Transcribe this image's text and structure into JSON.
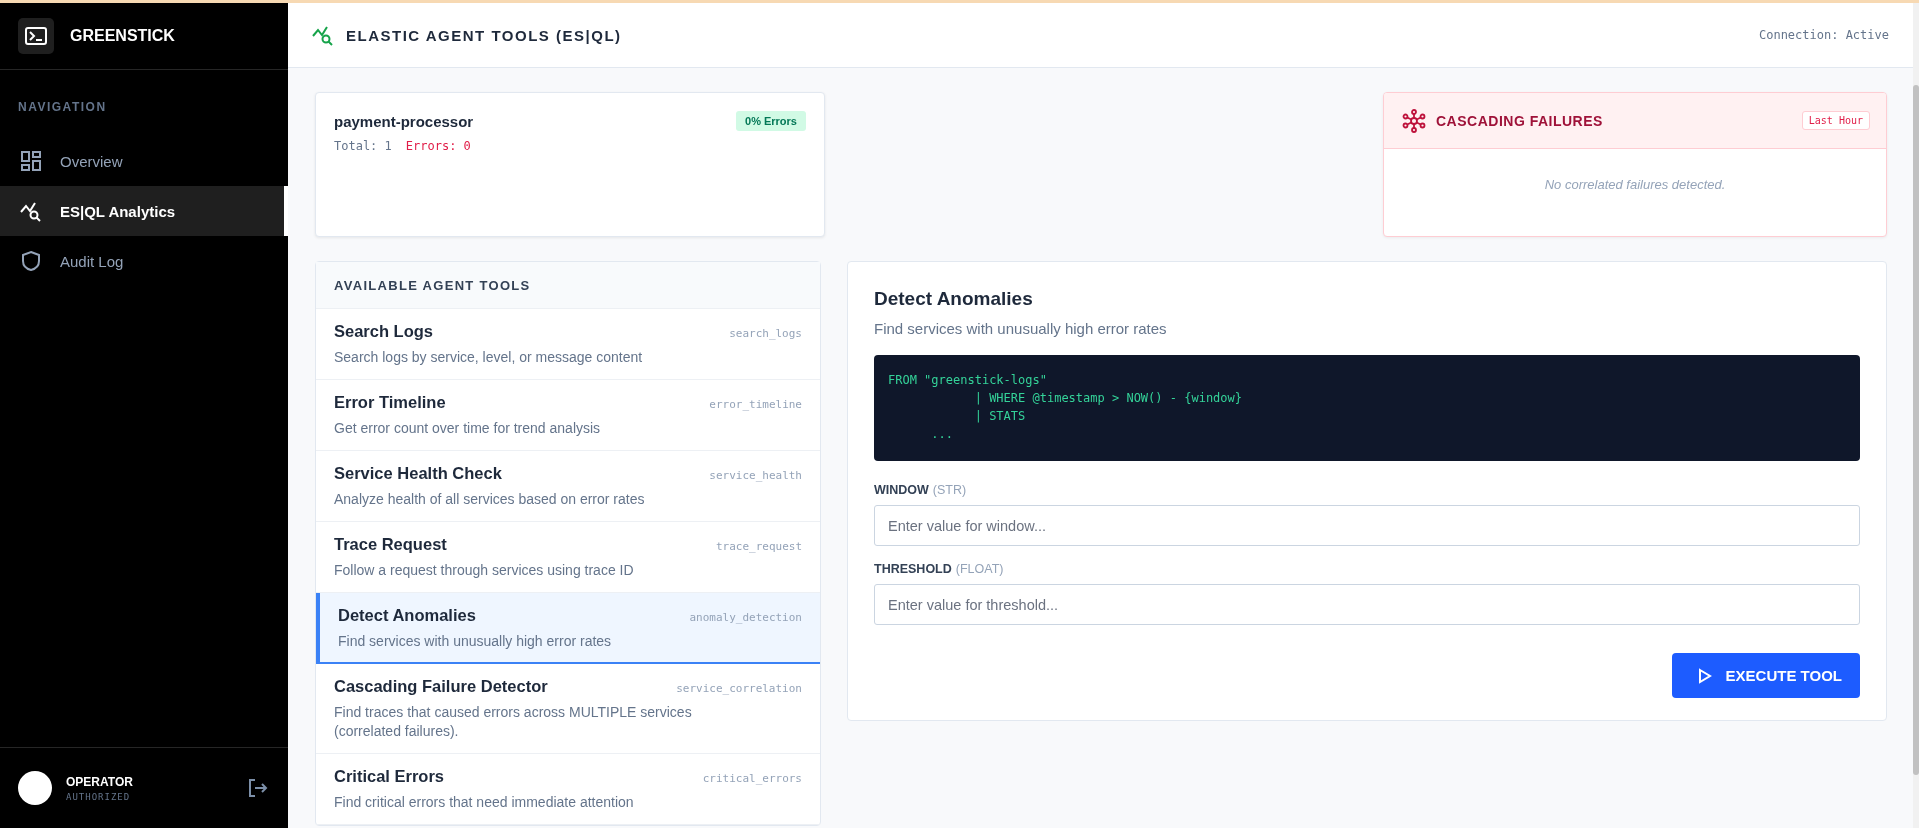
{
  "brand": {
    "name": "GREENSTICK"
  },
  "sidebar": {
    "section": "NAVIGATION",
    "items": [
      {
        "label": "Overview",
        "kind": "grid",
        "selected": false
      },
      {
        "label": "ES|QL Analytics",
        "kind": "chart",
        "selected": true
      },
      {
        "label": "Audit Log",
        "kind": "shield",
        "selected": false
      }
    ],
    "user": {
      "name": "OPERATOR",
      "role": "AUTHORIZED"
    }
  },
  "header": {
    "title": "ELASTIC AGENT TOOLS (ES|QL)",
    "status": "Connection: Active"
  },
  "service_card": {
    "name": "payment-processor",
    "badge": "0% Errors",
    "total": "Total: 1",
    "errors": "Errors: 0"
  },
  "cascading": {
    "title": "CASCADING FAILURES",
    "badge": "Last Hour",
    "empty": "No correlated failures detected."
  },
  "tools": {
    "title": "AVAILABLE AGENT TOOLS",
    "items": [
      {
        "name": "Search Logs",
        "id": "search_logs",
        "description": "Search logs by service, level, or message content",
        "selected": false
      },
      {
        "name": "Error Timeline",
        "id": "error_timeline",
        "description": "Get error count over time for trend analysis",
        "selected": false
      },
      {
        "name": "Service Health Check",
        "id": "service_health",
        "description": "Analyze health of all services based on error rates",
        "selected": false
      },
      {
        "name": "Trace Request",
        "id": "trace_request",
        "description": "Follow a request through services using trace ID",
        "selected": false
      },
      {
        "name": "Detect Anomalies",
        "id": "anomaly_detection",
        "description": "Find services with unusually high error rates",
        "selected": true
      },
      {
        "name": "Cascading Failure Detector",
        "id": "service_correlation",
        "description": "Find traces that caused errors across MULTIPLE services (correlated failures).",
        "selected": false
      },
      {
        "name": "Critical Errors",
        "id": "critical_errors",
        "description": "Find critical errors that need immediate attention",
        "selected": false
      }
    ]
  },
  "detail": {
    "title": "Detect Anomalies",
    "description": "Find services with unusually high error rates",
    "query": "FROM \"greenstick-logs\"\n            | WHERE @timestamp > NOW() - {window}\n            | STATS\n      ...",
    "params": [
      {
        "name": "WINDOW",
        "type": "(STR)",
        "placeholder": "Enter value for window..."
      },
      {
        "name": "THRESHOLD",
        "type": "(FLOAT)",
        "placeholder": "Enter value for threshold..."
      }
    ],
    "button": "EXECUTE TOOL"
  }
}
